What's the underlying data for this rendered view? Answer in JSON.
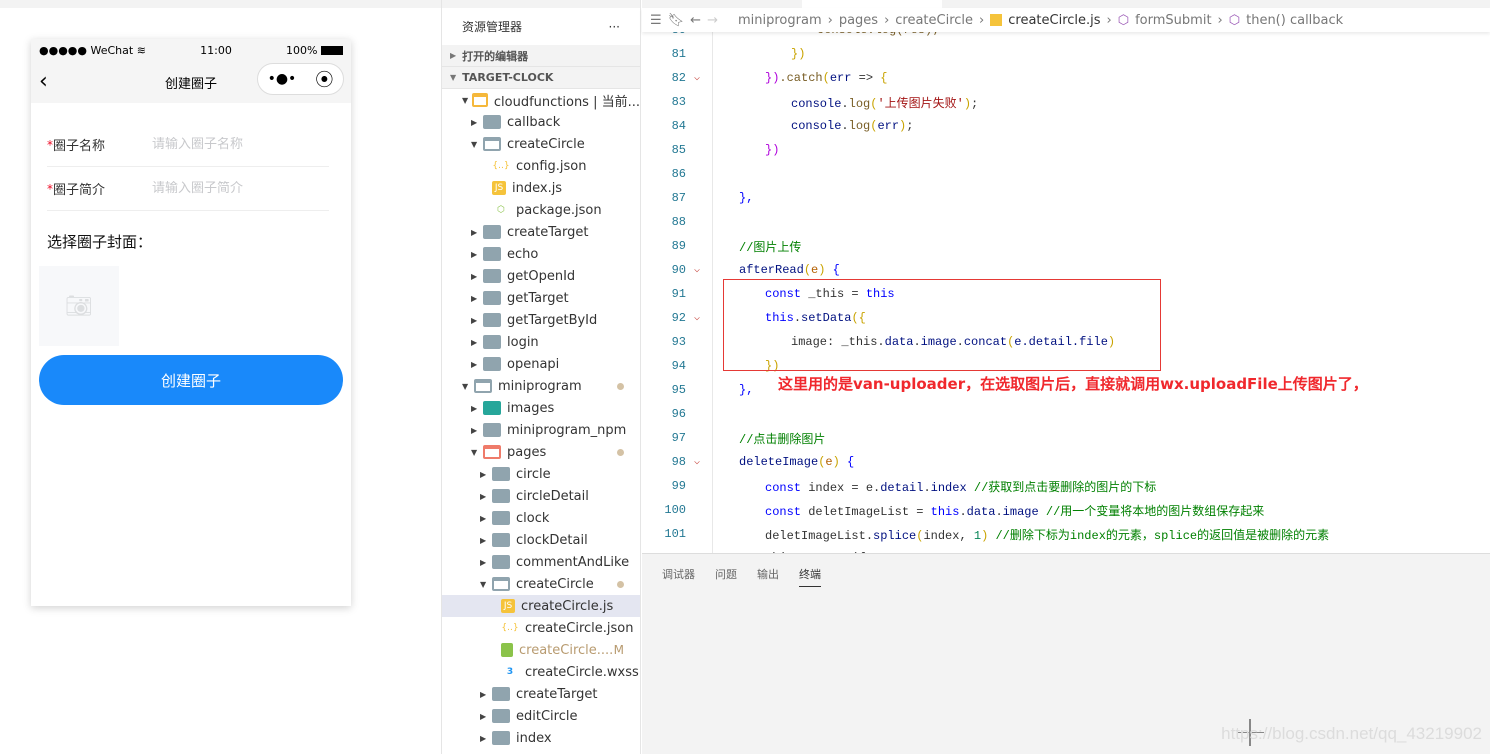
{
  "simulator": {
    "status": {
      "carrier": "●●●●● WeChat",
      "wifi_icon": "wifi-icon",
      "time": "11:00",
      "battery": "100%"
    },
    "nav": {
      "title": "创建圈子",
      "back_icon": "chevron-left-icon",
      "more": "•●•",
      "home_icon": "target-icon"
    },
    "fields": [
      {
        "required": "*",
        "label": "圈子名称",
        "placeholder": "请输入圈子名称"
      },
      {
        "required": "*",
        "label": "圈子简介",
        "placeholder": "请输入圈子简介"
      }
    ],
    "cover_label": "选择圈子封面：",
    "upload_icon": "camera-icon",
    "submit": "创建圈子",
    "colors": {
      "primary": "#1989fa",
      "required": "#ee0a24"
    }
  },
  "explorer": {
    "title": "资源管理器",
    "more": "···",
    "sections": [
      "打开的编辑器",
      "TARGET-CLOCK"
    ],
    "rows": [
      {
        "label": "cloudfunctions | 当前...",
        "depth": 0,
        "type": "cloudfolder",
        "open": true
      },
      {
        "label": "callback",
        "depth": 1,
        "type": "folder"
      },
      {
        "label": "createCircle",
        "depth": 1,
        "type": "folder",
        "open": true
      },
      {
        "label": "config.json",
        "depth": 2,
        "type": "json"
      },
      {
        "label": "index.js",
        "depth": 2,
        "type": "js"
      },
      {
        "label": "package.json",
        "depth": 2,
        "type": "npm"
      },
      {
        "label": "createTarget",
        "depth": 1,
        "type": "folder"
      },
      {
        "label": "echo",
        "depth": 1,
        "type": "folder"
      },
      {
        "label": "getOpenId",
        "depth": 1,
        "type": "folder"
      },
      {
        "label": "getTarget",
        "depth": 1,
        "type": "folder"
      },
      {
        "label": "getTargetById",
        "depth": 1,
        "type": "folder"
      },
      {
        "label": "login",
        "depth": 1,
        "type": "folder"
      },
      {
        "label": "openapi",
        "depth": 1,
        "type": "folder"
      },
      {
        "label": "miniprogram",
        "depth": 0,
        "type": "folder",
        "open": true,
        "dot": true
      },
      {
        "label": "images",
        "depth": 1,
        "type": "imgfolder"
      },
      {
        "label": "miniprogram_npm",
        "depth": 1,
        "type": "folder"
      },
      {
        "label": "pages",
        "depth": 1,
        "type": "pagesfolder",
        "open": true,
        "dot": true
      },
      {
        "label": "circle",
        "depth": 2,
        "type": "folder"
      },
      {
        "label": "circleDetail",
        "depth": 2,
        "type": "folder"
      },
      {
        "label": "clock",
        "depth": 2,
        "type": "folder"
      },
      {
        "label": "clockDetail",
        "depth": 2,
        "type": "folder"
      },
      {
        "label": "commentAndLike",
        "depth": 2,
        "type": "folder"
      },
      {
        "label": "createCircle",
        "depth": 2,
        "type": "folder",
        "open": true,
        "dot": true
      },
      {
        "label": "createCircle.js",
        "depth": 3,
        "type": "js",
        "selected": true
      },
      {
        "label": "createCircle.json",
        "depth": 3,
        "type": "json"
      },
      {
        "label": "createCircle....",
        "depth": 3,
        "type": "wxml",
        "badge": "M"
      },
      {
        "label": "createCircle.wxss",
        "depth": 3,
        "type": "css"
      },
      {
        "label": "createTarget",
        "depth": 2,
        "type": "folder"
      },
      {
        "label": "editCircle",
        "depth": 2,
        "type": "folder"
      },
      {
        "label": "index",
        "depth": 2,
        "type": "folder"
      }
    ]
  },
  "editor": {
    "breadcrumb": [
      "miniprogram",
      "pages",
      "createCircle",
      "createCircle.js",
      "formSubmit",
      "then() callback"
    ],
    "lines": [
      {
        "n": "80",
        "fold": false,
        "indent": 3,
        "t": [
          [
            "console.log(res);",
            "f"
          ]
        ]
      },
      {
        "n": "81",
        "fold": false,
        "indent": 2,
        "t": [
          [
            "})",
            "y"
          ]
        ]
      },
      {
        "n": "82",
        "fold": true,
        "indent": 1,
        "t": [
          [
            "})",
            "p"
          ],
          [
            ".catch",
            "f"
          ],
          [
            "(",
            "y"
          ],
          [
            "err",
            "v"
          ],
          [
            " => ",
            ""
          ],
          [
            "{",
            "y"
          ]
        ]
      },
      {
        "n": "83",
        "fold": false,
        "indent": 2,
        "t": [
          [
            "console",
            "v"
          ],
          [
            ".",
            ""
          ],
          [
            "log",
            "f"
          ],
          [
            "(",
            "y"
          ],
          [
            "'上传图片失败'",
            "s"
          ],
          [
            ")",
            "y"
          ],
          [
            ";",
            ""
          ]
        ]
      },
      {
        "n": "84",
        "fold": false,
        "indent": 2,
        "t": [
          [
            "console",
            "v"
          ],
          [
            ".",
            ""
          ],
          [
            "log",
            "f"
          ],
          [
            "(",
            "y"
          ],
          [
            "err",
            "v"
          ],
          [
            ")",
            "y"
          ],
          [
            ";",
            ""
          ]
        ]
      },
      {
        "n": "85",
        "fold": false,
        "indent": 1,
        "t": [
          [
            "})",
            "p"
          ]
        ]
      },
      {
        "n": "86",
        "fold": false,
        "indent": 0,
        "t": []
      },
      {
        "n": "87",
        "fold": false,
        "indent": 0,
        "t": [
          [
            "},",
            "k"
          ]
        ]
      },
      {
        "n": "88",
        "fold": false,
        "indent": 0,
        "t": []
      },
      {
        "n": "89",
        "fold": false,
        "indent": 0,
        "t": [
          [
            "//图片上传",
            "c"
          ]
        ]
      },
      {
        "n": "90",
        "fold": true,
        "indent": 0,
        "t": [
          [
            "afterRead",
            "v"
          ],
          [
            "(",
            "y"
          ],
          [
            "e",
            "o"
          ],
          [
            ") ",
            "y"
          ],
          [
            "{",
            "k"
          ]
        ]
      },
      {
        "n": "91",
        "fold": false,
        "indent": 1,
        "t": [
          [
            "const",
            "k"
          ],
          [
            " _this = ",
            ""
          ],
          [
            "this",
            "k"
          ]
        ]
      },
      {
        "n": "92",
        "fold": true,
        "indent": 1,
        "t": [
          [
            "this",
            "k"
          ],
          [
            ".",
            ""
          ],
          [
            "setData",
            "v"
          ],
          [
            "({",
            "y"
          ]
        ]
      },
      {
        "n": "93",
        "fold": false,
        "indent": 2,
        "t": [
          [
            "image",
            ""
          ],
          [
            ": _this.",
            ""
          ],
          [
            "data",
            "v"
          ],
          [
            ".",
            ""
          ],
          [
            "image",
            "v"
          ],
          [
            ".",
            ""
          ],
          [
            "concat",
            "v"
          ],
          [
            "(",
            "y"
          ],
          [
            "e.detail.file",
            "v"
          ],
          [
            ")",
            "y"
          ]
        ]
      },
      {
        "n": "94",
        "fold": false,
        "indent": 1,
        "t": [
          [
            "})",
            "y"
          ]
        ]
      },
      {
        "n": "95",
        "fold": false,
        "indent": 0,
        "t": [
          [
            "},",
            "k"
          ]
        ]
      },
      {
        "n": "96",
        "fold": false,
        "indent": 0,
        "t": []
      },
      {
        "n": "97",
        "fold": false,
        "indent": 0,
        "t": [
          [
            "//点击删除图片",
            "c"
          ]
        ]
      },
      {
        "n": "98",
        "fold": true,
        "indent": 0,
        "t": [
          [
            "deleteImage",
            "v"
          ],
          [
            "(",
            "y"
          ],
          [
            "e",
            "o"
          ],
          [
            ") ",
            "y"
          ],
          [
            "{",
            "k"
          ]
        ]
      },
      {
        "n": "99",
        "fold": false,
        "indent": 1,
        "t": [
          [
            "const",
            "k"
          ],
          [
            " index = e.",
            ""
          ],
          [
            "detail",
            "v"
          ],
          [
            ".",
            ""
          ],
          [
            "index",
            "v"
          ],
          [
            " //获取到点击要删除的图片的下标",
            "c"
          ]
        ]
      },
      {
        "n": "100",
        "fold": false,
        "indent": 1,
        "t": [
          [
            "const",
            "k"
          ],
          [
            " deletImageList = ",
            ""
          ],
          [
            "this",
            "k"
          ],
          [
            ".",
            ""
          ],
          [
            "data",
            "v"
          ],
          [
            ".",
            ""
          ],
          [
            "image",
            "v"
          ],
          [
            " //用一个变量将本地的图片数组保存起来",
            "c"
          ]
        ]
      },
      {
        "n": "101",
        "fold": false,
        "indent": 1,
        "t": [
          [
            "deletImageList.",
            ""
          ],
          [
            "splice",
            "v"
          ],
          [
            "(",
            "y"
          ],
          [
            "index, ",
            ""
          ],
          [
            "1",
            "n"
          ],
          [
            ")",
            "y"
          ],
          [
            " //删除下标为index的元素，splice的返回值是被删除的元素",
            "c"
          ]
        ]
      },
      {
        "n": "102",
        "fold": true,
        "indent": 1,
        "t": [
          [
            "this.setData({",
            ""
          ]
        ]
      }
    ],
    "annotation": "这里用的是van-uploader，在选取图片后，直接就调用wx.uploadFile上传图片了，",
    "annotation_color": "#f0282d",
    "panel_tabs": [
      "调试器",
      "问题",
      "输出",
      "终端"
    ],
    "active_panel_tab": "终端"
  },
  "watermark": "https://blog.csdn.net/qq_43219902"
}
